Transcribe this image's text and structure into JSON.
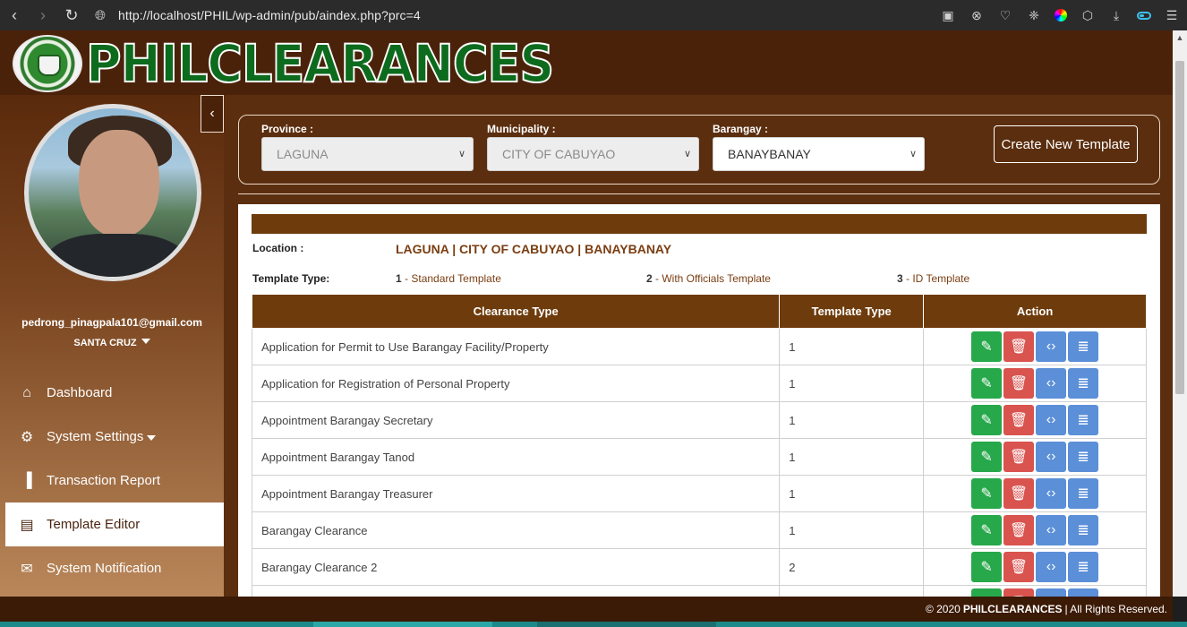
{
  "browser": {
    "url": "http://localhost/PHIL/wp-admin/pub/aindex.php?prc=4"
  },
  "brand": {
    "name": "PHILCLEARANCES"
  },
  "user": {
    "email": "pedrong_pinagpala101@gmail.com",
    "location": "SANTA CRUZ"
  },
  "nav": {
    "items": [
      {
        "label": "Dashboard",
        "icon": "home-icon"
      },
      {
        "label": "System Settings",
        "icon": "gear-icon"
      },
      {
        "label": "Transaction Report",
        "icon": "bar-chart-icon"
      },
      {
        "label": "Template Editor",
        "icon": "id-card-icon",
        "active": true
      },
      {
        "label": "System Notification",
        "icon": "envelope-icon"
      }
    ]
  },
  "filters": {
    "province_label": "Province :",
    "province_value": "LAGUNA",
    "municipality_label": "Municipality :",
    "municipality_value": "CITY OF CABUYAO",
    "barangay_label": "Barangay :",
    "barangay_value": "BANAYBANAY",
    "create_button": "Create New Template"
  },
  "location": {
    "label": "Location :",
    "value": "LAGUNA | CITY OF CABUYAO | BANAYBANAY"
  },
  "template_types": {
    "label": "Template Type:",
    "options": [
      {
        "num": "1",
        "text": " - Standard Template"
      },
      {
        "num": "2",
        "text": " - With Officials Template"
      },
      {
        "num": "3",
        "text": " - ID Template"
      }
    ]
  },
  "table": {
    "headers": [
      "Clearance Type",
      "Template Type",
      "Action"
    ],
    "rows": [
      {
        "clearance": "Application for Permit to Use Barangay Facility/Property",
        "type": "1"
      },
      {
        "clearance": "Application for Registration of Personal Property",
        "type": "1"
      },
      {
        "clearance": "Appointment Barangay Secretary",
        "type": "1"
      },
      {
        "clearance": "Appointment Barangay Tanod",
        "type": "1"
      },
      {
        "clearance": "Appointment Barangay Treasurer",
        "type": "1"
      },
      {
        "clearance": "Barangay Clearance",
        "type": "1"
      },
      {
        "clearance": "Barangay Clearance 2",
        "type": "2"
      },
      {
        "clearance": "",
        "type": ""
      }
    ]
  },
  "footer": {
    "prefix": "© 2020",
    "brand": "PHILCLEARANCES",
    "suffix": "| All Rights Reserved."
  },
  "colors": {
    "brand_brown": "#5b2e0f",
    "header_brown": "#6e3b0c",
    "edit_green": "#27a84a",
    "delete_red": "#d9534f",
    "action_blue": "#5b8fd8"
  }
}
